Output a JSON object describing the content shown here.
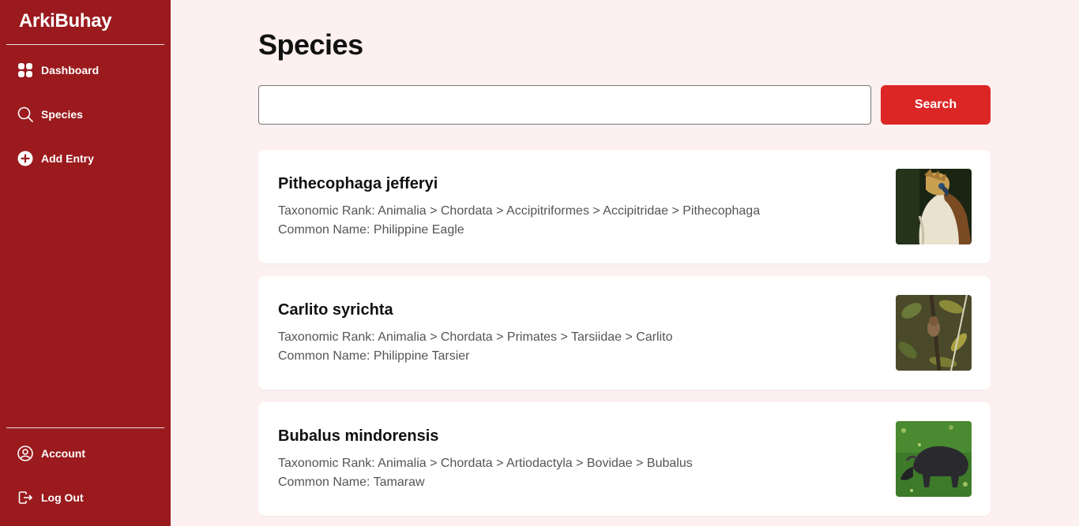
{
  "sidebar": {
    "brand": "ArkiBuhay",
    "items": [
      {
        "label": "Dashboard",
        "icon": "grid-icon"
      },
      {
        "label": "Species",
        "icon": "search-icon"
      },
      {
        "label": "Add Entry",
        "icon": "plus-circle-icon"
      }
    ],
    "bottom_items": [
      {
        "label": "Account",
        "icon": "user-circle-icon"
      },
      {
        "label": "Log Out",
        "icon": "logout-icon"
      }
    ],
    "colors": {
      "background": "#9a1a1e",
      "text": "#ffffff"
    }
  },
  "main": {
    "title": "Species",
    "search": {
      "value": "",
      "placeholder": "",
      "button_label": "Search",
      "button_color": "#dc2626"
    },
    "species": [
      {
        "name": "Pithecophaga jefferyi",
        "taxonomy": "Taxonomic Rank: Animalia > Chordata > Accipitriformes > Accipitridae > Pithecophaga",
        "common": "Common Name: Philippine Eagle",
        "image": "eagle-photo"
      },
      {
        "name": "Carlito syrichta",
        "taxonomy": "Taxonomic Rank: Animalia > Chordata > Primates > Tarsiidae > Carlito",
        "common": "Common Name: Philippine Tarsier",
        "image": "tarsier-photo"
      },
      {
        "name": "Bubalus mindorensis",
        "taxonomy": "Taxonomic Rank: Animalia > Chordata > Artiodactyla > Bovidae > Bubalus",
        "common": "Common Name: Tamaraw",
        "image": "tamaraw-photo"
      }
    ]
  }
}
